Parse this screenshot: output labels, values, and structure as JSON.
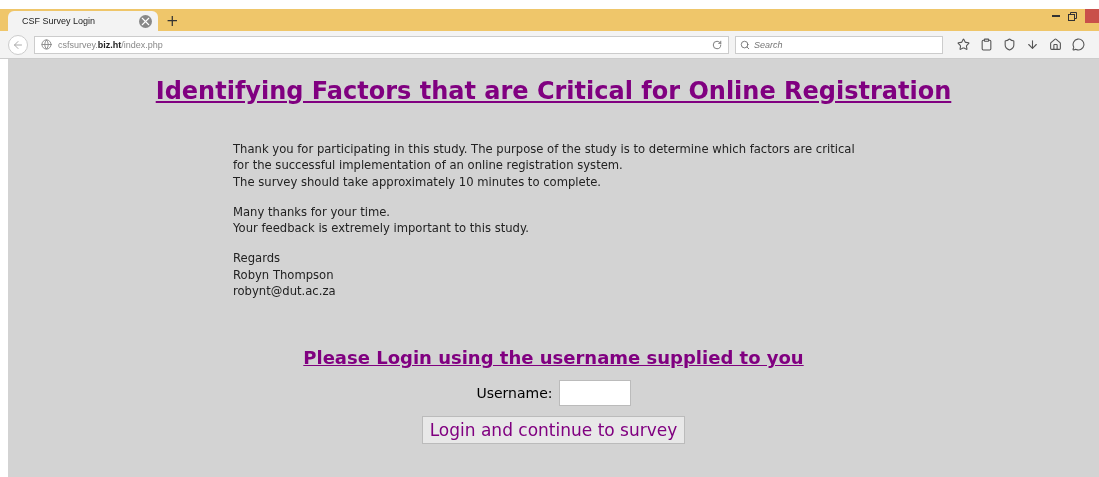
{
  "browser": {
    "tab": {
      "title": "CSF Survey Login",
      "selected": true
    },
    "new_tab": "+",
    "address": "csfsurvey.**biz.ht**/index.php",
    "search": {
      "placeholder": "Search"
    }
  },
  "page": {
    "title": "Identifying Factors that are Critical for Online Registration",
    "paragraphs": [
      [
        "Thank you for participating in this study. The purpose of the study is to determine which factors are critical",
        "for the successful implementation of an online registration system.",
        "The survey should take approximately 10 minutes to complete."
      ],
      [
        "Many thanks for your time.",
        "Your feedback is extremely important to this study."
      ],
      [
        "Regards",
        "Robyn Thompson",
        "robynt@dut.ac.za"
      ]
    ],
    "login_heading": "Please Login using the username supplied to you",
    "username_label": "Username:",
    "button": "Login and continue to survey"
  }
}
